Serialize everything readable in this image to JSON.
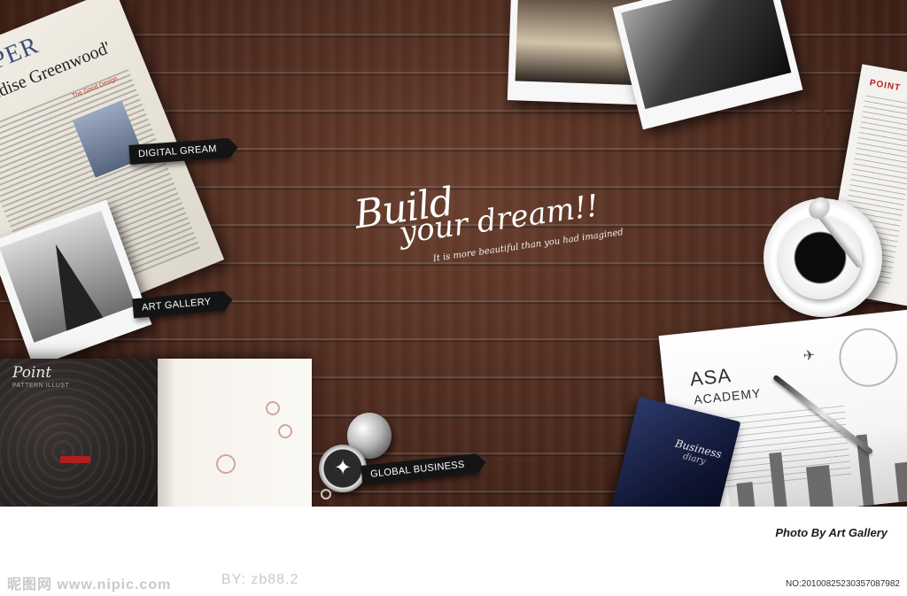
{
  "newspaper": {
    "masthead": "PAPER",
    "headline": "Paradise Greenwood'",
    "side_note": "The Good Design"
  },
  "ribbons": {
    "digital": "DIGITAL GREAM",
    "gallery": "ART GALLERY",
    "business": "GLOBAL BUSINESS"
  },
  "notebook": {
    "title": "Point",
    "subtitle": "PATTERN ILLUST"
  },
  "headline": {
    "line1": "Build",
    "line2": "your dream!!",
    "tagline": "It is more beautiful than you had imagined"
  },
  "paper_right": {
    "title": "POINT"
  },
  "postcard": {
    "brand": "ASA",
    "subtitle": "ACADEMY"
  },
  "diary": {
    "line1": "Business",
    "line2": "diary"
  },
  "footer": {
    "credit": "Photo By Art Gallery",
    "watermark_site": "昵图网 www.nipic.com",
    "watermark_by": "BY: zb88.2",
    "image_no": "NO:20100825230357087982"
  },
  "colors": {
    "wood": "#4c2a1f",
    "ribbon": "#141414",
    "credit_text": "#1c1c1c",
    "watermark": "#c9c9c9"
  }
}
